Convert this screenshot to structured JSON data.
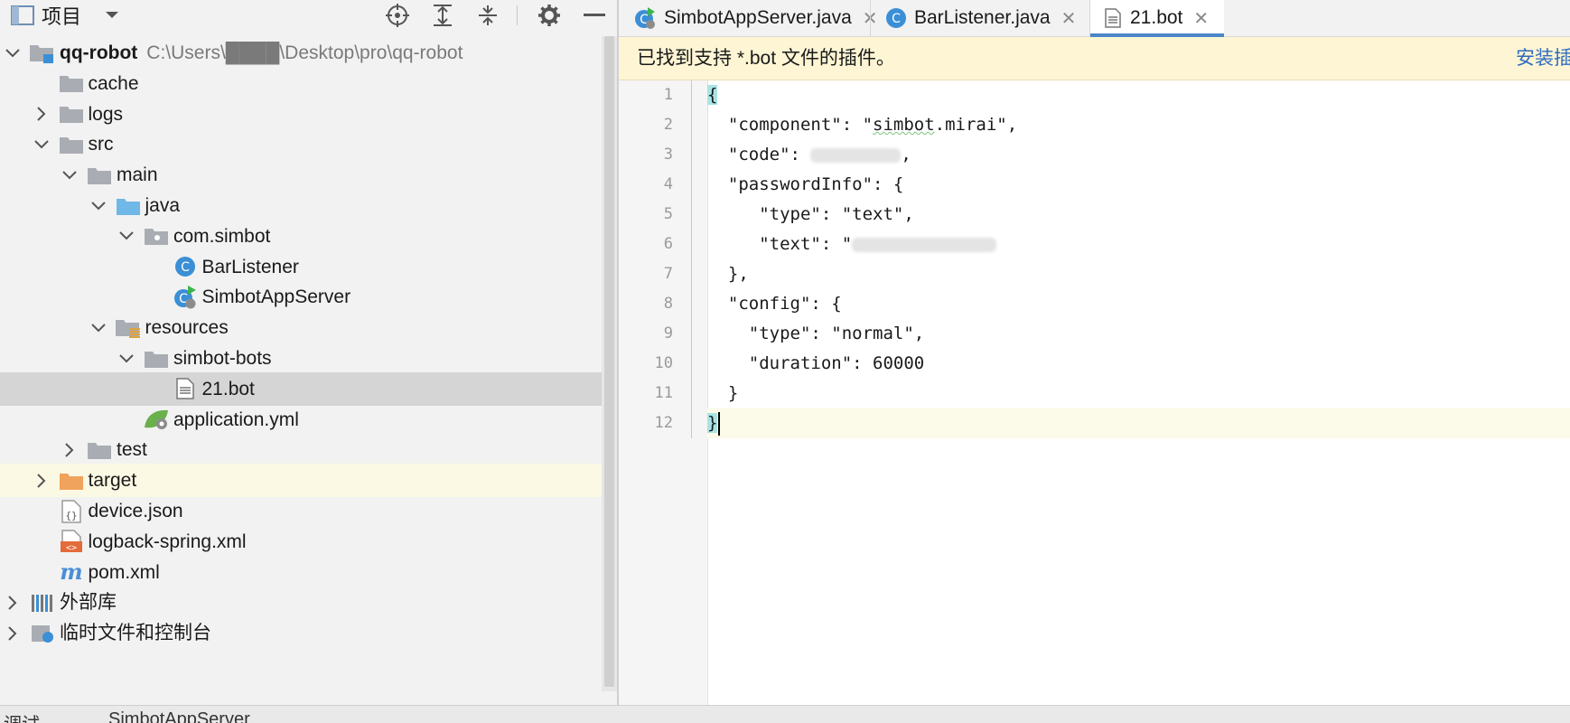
{
  "project_panel": {
    "title": "项目",
    "tree": [
      {
        "label": "qq-robot",
        "path": "C:\\Users\\████\\Desktop\\pro\\qq-robot",
        "bold": true,
        "indent": 0,
        "arrow": "down",
        "icon": "module-folder"
      },
      {
        "label": "cache",
        "indent": 1,
        "arrow": "",
        "icon": "folder"
      },
      {
        "label": "logs",
        "indent": 1,
        "arrow": "right",
        "icon": "folder"
      },
      {
        "label": "src",
        "indent": 1,
        "arrow": "down",
        "icon": "folder"
      },
      {
        "label": "main",
        "indent": 2,
        "arrow": "down",
        "icon": "folder"
      },
      {
        "label": "java",
        "indent": 3,
        "arrow": "down",
        "icon": "source-folder"
      },
      {
        "label": "com.simbot",
        "indent": 4,
        "arrow": "down",
        "icon": "package"
      },
      {
        "label": "BarListener",
        "indent": 5,
        "arrow": "",
        "icon": "java-class"
      },
      {
        "label": "SimbotAppServer",
        "indent": 5,
        "arrow": "",
        "icon": "spring-boot-class"
      },
      {
        "label": "resources",
        "indent": 3,
        "arrow": "down",
        "icon": "resources-folder"
      },
      {
        "label": "simbot-bots",
        "indent": 4,
        "arrow": "down",
        "icon": "folder"
      },
      {
        "label": "21.bot",
        "indent": 5,
        "arrow": "",
        "icon": "text-file",
        "selected": true
      },
      {
        "label": "application.yml",
        "indent": 4,
        "arrow": "",
        "icon": "spring-config"
      },
      {
        "label": "test",
        "indent": 2,
        "arrow": "right",
        "icon": "folder"
      },
      {
        "label": "target",
        "indent": 1,
        "arrow": "right",
        "icon": "excluded-folder",
        "highlight": true
      },
      {
        "label": "device.json",
        "indent": 1,
        "arrow": "",
        "icon": "json-file"
      },
      {
        "label": "logback-spring.xml",
        "indent": 1,
        "arrow": "",
        "icon": "xml-file"
      },
      {
        "label": "pom.xml",
        "indent": 1,
        "arrow": "",
        "icon": "maven-file"
      },
      {
        "label": "外部库",
        "indent": 0,
        "arrow": "right",
        "icon": "library"
      },
      {
        "label": "临时文件和控制台",
        "indent": 0,
        "arrow": "right",
        "icon": "scratch"
      }
    ]
  },
  "tabs": [
    {
      "label": "SimbotAppServer.java",
      "icon": "spring-boot-class",
      "active": false
    },
    {
      "label": "BarListener.java",
      "icon": "java-class",
      "active": false
    },
    {
      "label": "21.bot",
      "icon": "text-file",
      "active": true
    }
  ],
  "notice": {
    "text": "已找到支持 *.bot 文件的插件。",
    "action": "安装插"
  },
  "editor": {
    "line_numbers": [
      "1",
      "2",
      "3",
      "4",
      "5",
      "6",
      "7",
      "8",
      "9",
      "10",
      "11",
      "12"
    ],
    "current_line": 12
  },
  "statusbar": {
    "left": "调试",
    "middle": "SimbotAppServer"
  },
  "colors": {
    "accent": "#4a86c8",
    "notice_bg": "#fdf5d4",
    "selected_row": "#d5d5d5",
    "java_class": "#3b8fd6",
    "excluded_folder": "#f0a35c"
  }
}
